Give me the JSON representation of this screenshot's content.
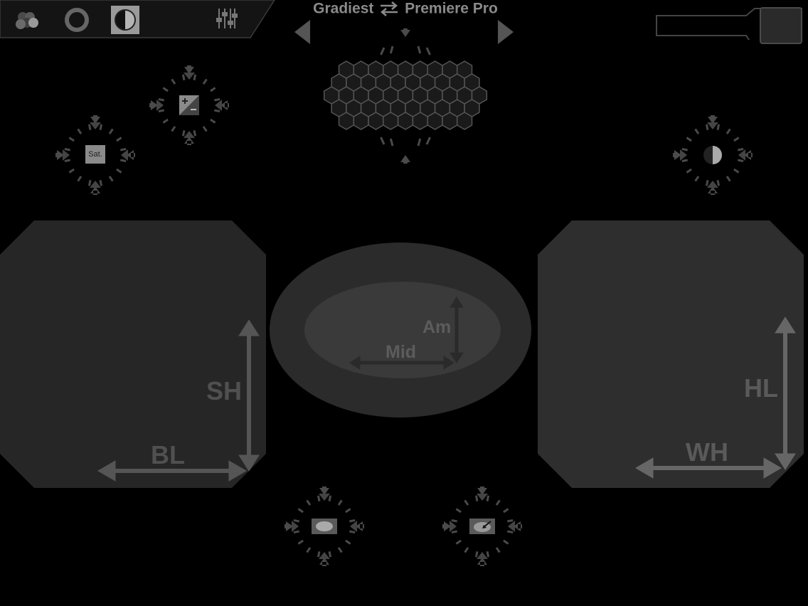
{
  "header": {
    "title_left": "Gradiest",
    "title_right": "Premiere Pro",
    "swap_icon": "swap-arrows-icon"
  },
  "toolbar": {
    "tools": [
      {
        "name": "color-circles-icon",
        "selected": false
      },
      {
        "name": "ring-icon",
        "selected": false
      },
      {
        "name": "half-circle-icon",
        "selected": true
      },
      {
        "name": "sliders-icon",
        "selected": false
      }
    ]
  },
  "knobs": {
    "saturation_label": "Sat.",
    "exposure_icon": "plus-minus-icon",
    "contrast_icon": "contrast-circle-icon",
    "vignette_icon": "vignette-icon",
    "eyedropper_icon": "eyedropper-icon",
    "hex_icon": "hex-grid-icon"
  },
  "pads": {
    "left": {
      "label_vertical": "SH",
      "label_horizontal": "BL"
    },
    "center": {
      "label_vertical": "Am",
      "label_horizontal": "Mid"
    },
    "right": {
      "label_vertical": "HL",
      "label_horizontal": "WH"
    }
  },
  "colors": {
    "background": "#000000",
    "pad": "#262626",
    "pad_right": "#2e2e2e",
    "oval_outer": "#2b2b2b",
    "oval_inner": "#3a3a3a",
    "arrow": "#5a5a5a",
    "icon": "#7a7a7a"
  }
}
